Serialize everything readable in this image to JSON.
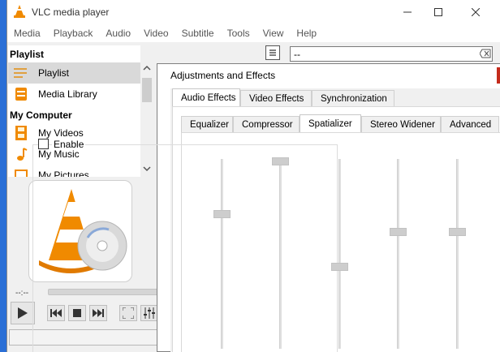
{
  "window": {
    "title": "VLC media player",
    "controls": [
      "minimize",
      "maximize",
      "close"
    ]
  },
  "menubar": [
    "Media",
    "Playback",
    "Audio",
    "Video",
    "Subtitle",
    "Tools",
    "View",
    "Help"
  ],
  "sidebar": {
    "playlist_header": "Playlist",
    "items": [
      {
        "label": "Playlist",
        "icon": "playlist-icon",
        "selected": true
      },
      {
        "label": "Media Library",
        "icon": "media-library-icon"
      }
    ],
    "computer_header": "My Computer",
    "computer_items": [
      {
        "label": "My Videos",
        "icon": "film-icon"
      },
      {
        "label": "My Music",
        "icon": "music-note-icon"
      },
      {
        "label": "My Pictures",
        "icon": "pictures-icon"
      }
    ]
  },
  "search": {
    "value": "--"
  },
  "player": {
    "time": "--:--"
  },
  "dialog": {
    "title": "Adjustments and Effects",
    "main_tabs": [
      "Audio Effects",
      "Video Effects",
      "Synchronization"
    ],
    "active_main_tab": "Audio Effects",
    "sub_tabs": [
      "Equalizer",
      "Compressor",
      "Spatializer",
      "Stereo Widener",
      "Advanced"
    ],
    "active_sub_tab": "Spatializer",
    "enable_label": "Enable",
    "enable_checked": false,
    "slider_levels": [
      0.7,
      1.0,
      0.4,
      0.6,
      0.6
    ]
  },
  "colors": {
    "desktop": "#2a6fd6",
    "vlc_orange": "#f08a00",
    "close_red": "#c42b1c"
  }
}
